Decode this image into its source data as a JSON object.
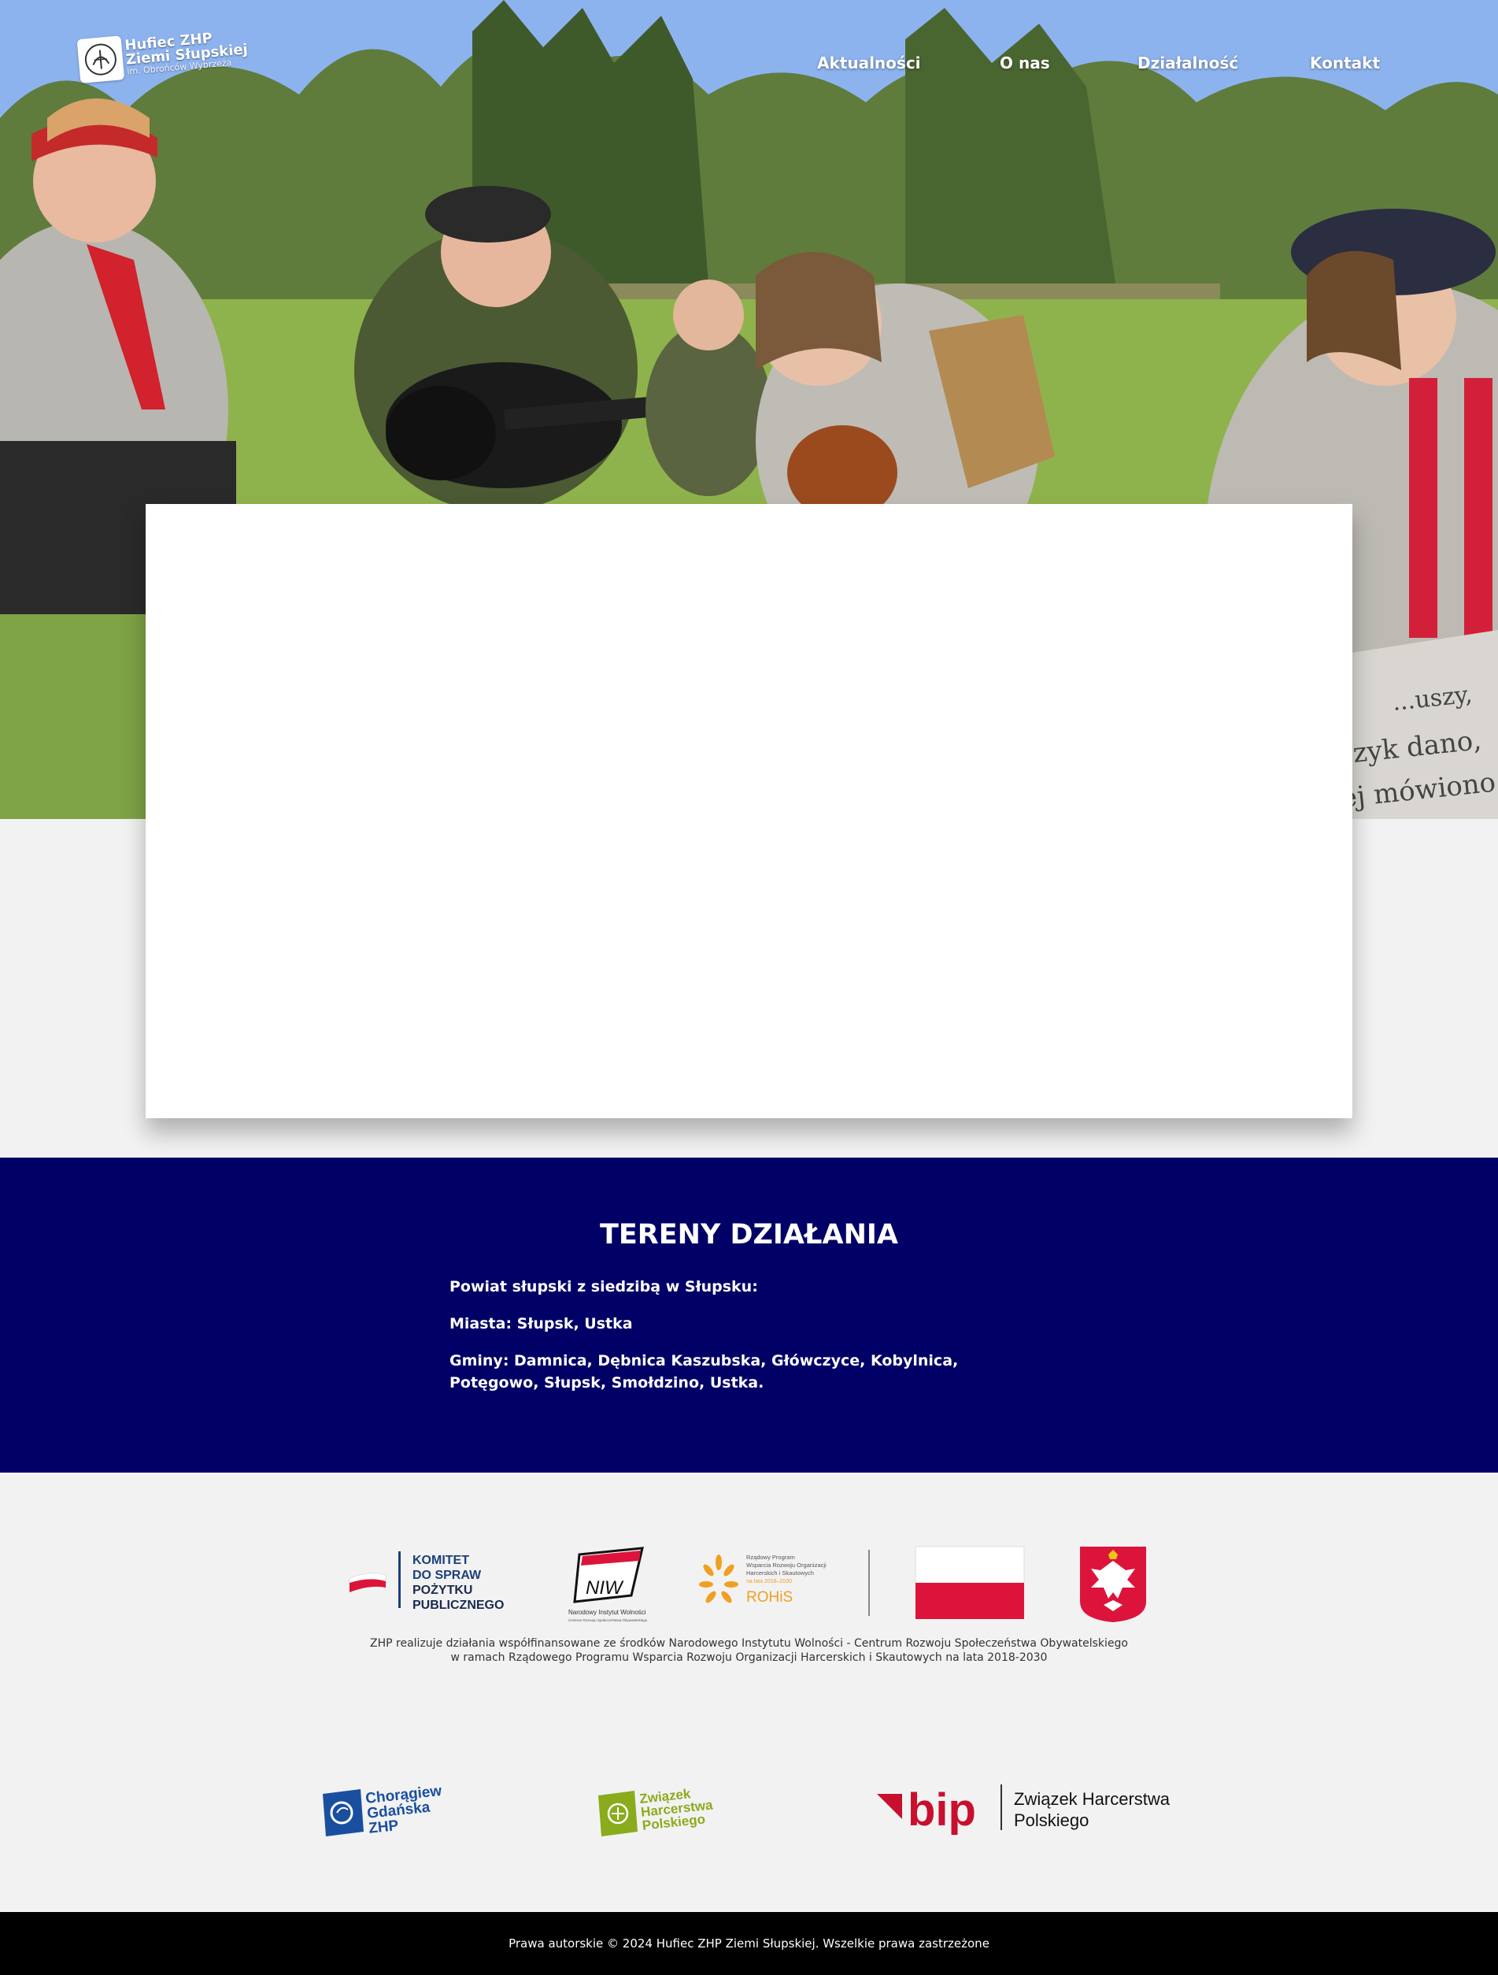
{
  "header": {
    "logo": {
      "line1": "Hufiec ZHP",
      "line2": "Ziemi Słupskiej",
      "line3": "im. Obrońców Wybrzeża"
    },
    "nav": [
      {
        "label": "Aktualności"
      },
      {
        "label": "O nas"
      },
      {
        "label": "Działalność"
      },
      {
        "label": "Kontakt"
      }
    ]
  },
  "hero": {
    "bag_text": [
      "...uszy,",
      "zyk dano,",
      "ej mówiono"
    ]
  },
  "tereny": {
    "title": "TERENY DZIAŁANIA",
    "paragraphs": [
      "Powiat słupski z siedzibą w Słupsku:",
      "Miasta: Słupsk, Ustka",
      "Gminy: Damnica, Dębnica Kaszubska, Główczyce, Kobylnica, Potęgowo, Słupsk, Smołdzino, Ustka."
    ]
  },
  "sponsors": {
    "kpp": [
      "KOMITET",
      "DO SPRAW",
      "POŻYTKU",
      "PUBLICZNEGO"
    ],
    "niw": {
      "abbr": "NIW",
      "name": "Narodowy Instytut Wolności",
      "sub": "Centrum Rozwoju Społeczeństwa Obywatelskiego"
    },
    "rohis": {
      "lines": [
        "Rządowy Program",
        "Wsparcia Rozwoju Organizacji",
        "Harcerskich i Skautowych"
      ],
      "years": "na lata 2018–2030",
      "name": "ROHiS"
    },
    "caption_line1": "ZHP realizuje działania współfinansowane ze środków Narodowego Instytutu Wolności - Centrum Rozwoju Społeczeństwa Obywatelskiego",
    "caption_line2": "w ramach Rządowego Programu Wsparcia Rozwoju Organizacji Harcerskich i Skautowych na lata 2018-2030"
  },
  "partners": {
    "choragiew": [
      "Chorągiew",
      "Gdańska",
      "ZHP"
    ],
    "zhp": [
      "Związek",
      "Harcerstwa",
      "Polskiego"
    ],
    "bip": {
      "mark": "bip",
      "line1": "Związek Harcerstwa",
      "line2": "Polskiego"
    }
  },
  "footer": {
    "copyright": "Prawa autorskie © 2024 Hufiec ZHP Ziemi Słupskiej. Wszelkie prawa zastrzeżone"
  },
  "colors": {
    "navy": "#000066",
    "footer_bg": "#000000",
    "page_bg": "#f2f2f2",
    "polish_red": "#dc143c",
    "kpp_blue": "#1d3f7a",
    "rohis_orange": "#f0a020",
    "choragiew_blue": "#1a4fa0",
    "zhp_green": "#8aab1c",
    "bip_red": "#c8102e"
  }
}
